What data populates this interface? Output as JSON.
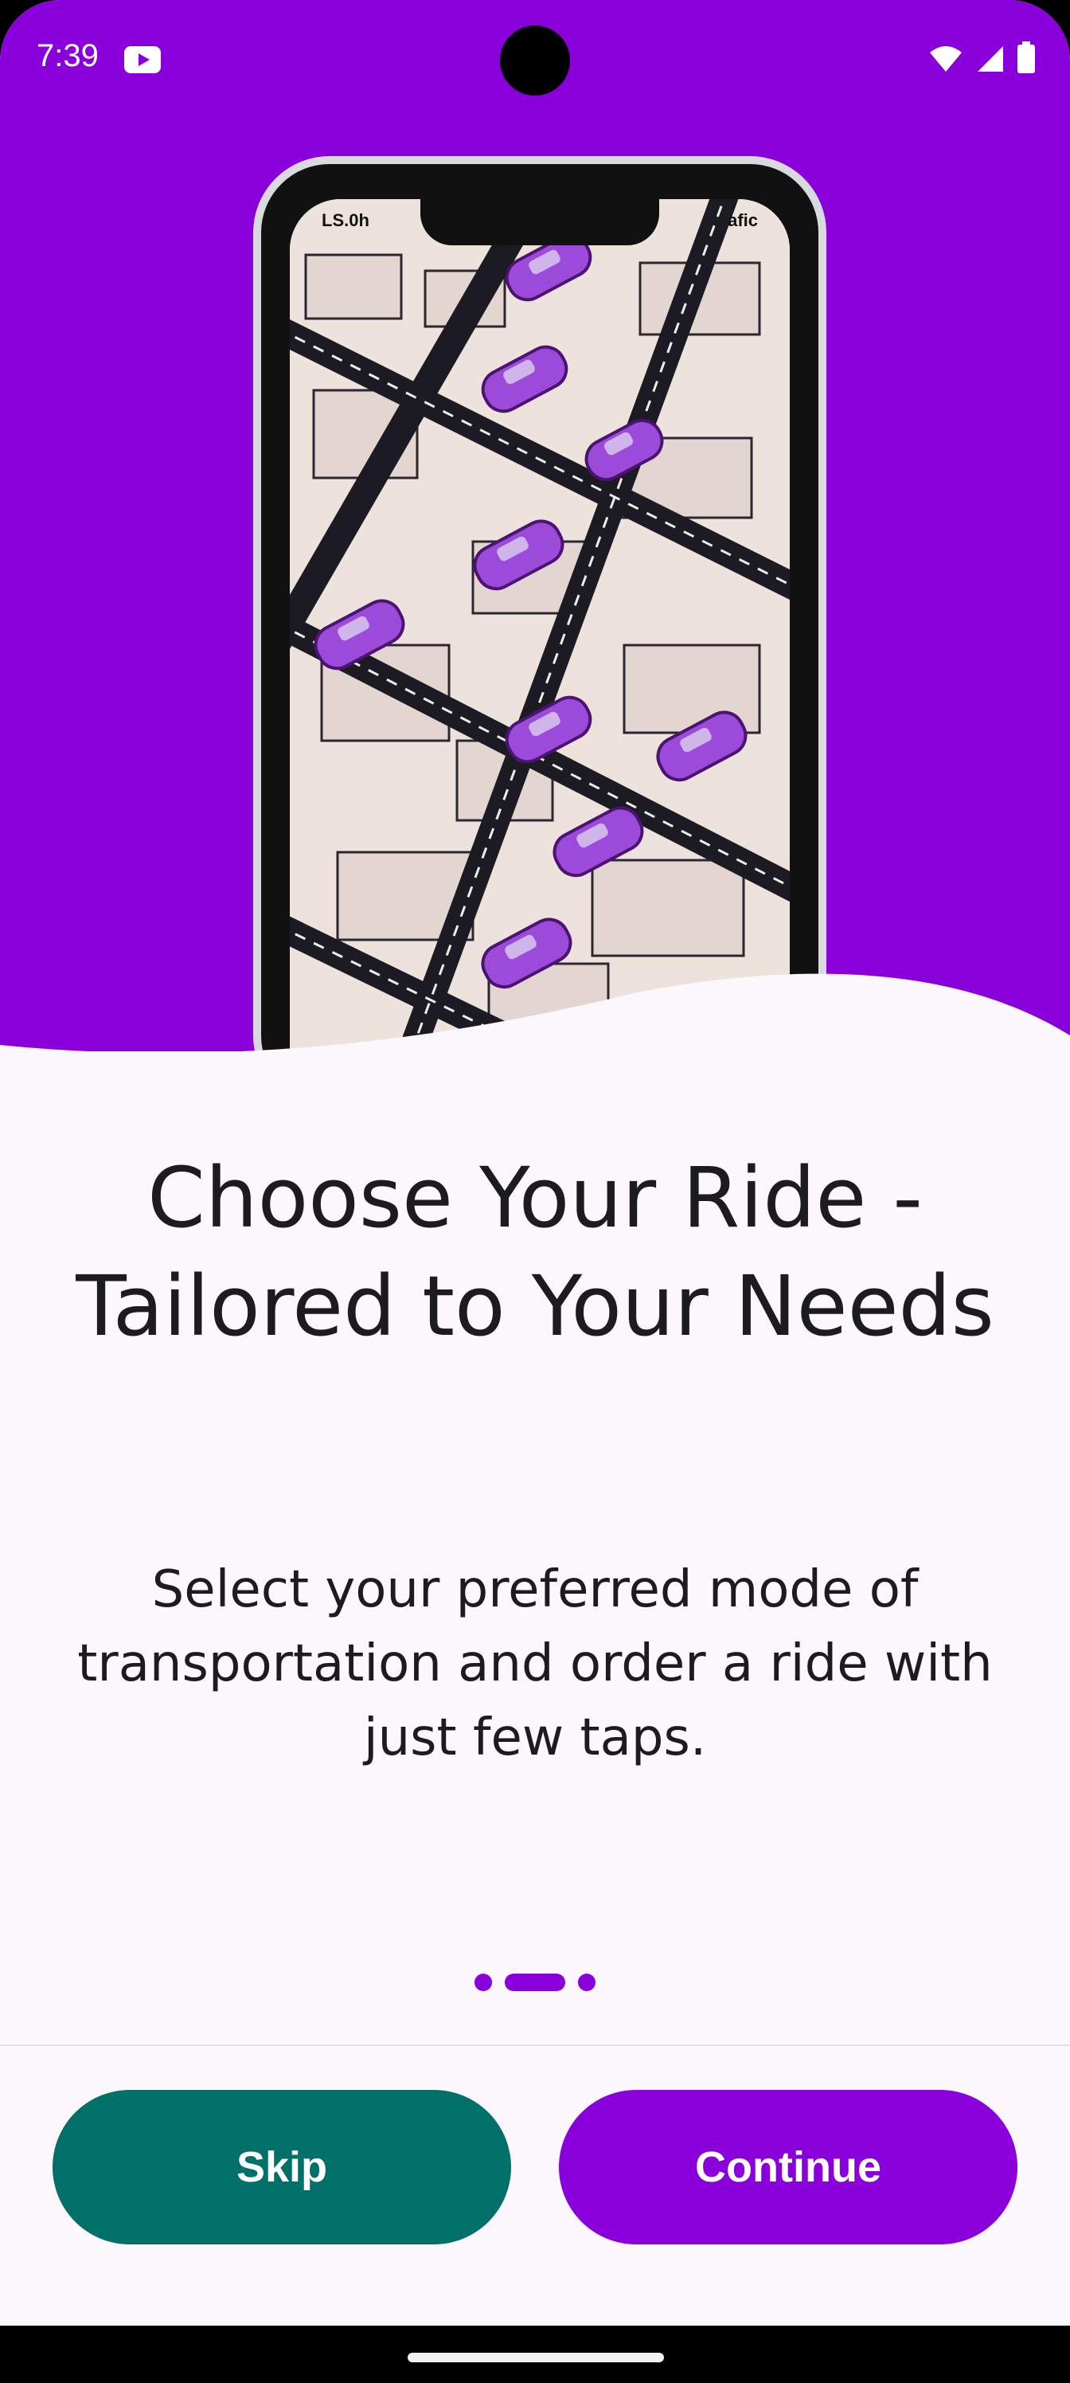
{
  "status_bar": {
    "time": "7:39"
  },
  "phone_mock": {
    "status_left": "LS.0h",
    "status_right": "afic"
  },
  "onboarding": {
    "title_line1": "Choose Your Ride -",
    "title_line2": "Tailored to Your Needs",
    "subtitle": "Select your preferred mode of transportation and order a ride with just few taps.",
    "page_indicator": {
      "total": 3,
      "current": 2
    }
  },
  "actions": {
    "skip_label": "Skip",
    "continue_label": "Continue"
  },
  "colors": {
    "primary": "#8a00da",
    "secondary": "#017069",
    "background": "#fcf7fc"
  }
}
